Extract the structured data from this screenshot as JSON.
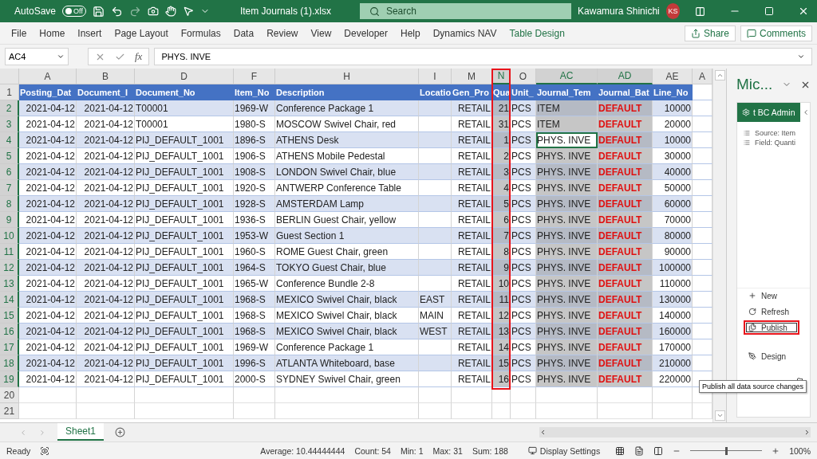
{
  "title_bar": {
    "autosave_label": "AutoSave",
    "autosave_text": "Off",
    "autosave_on": false,
    "file_name": "Item Journals (1).xlsx",
    "search_placeholder": "Search",
    "user_name": "Kawamura Shinichi",
    "user_initials": "KS"
  },
  "ribbon_tabs": [
    {
      "label": "File",
      "kind": "normal"
    },
    {
      "label": "Home",
      "kind": "normal"
    },
    {
      "label": "Insert",
      "kind": "normal"
    },
    {
      "label": "Page Layout",
      "kind": "normal"
    },
    {
      "label": "Formulas",
      "kind": "normal"
    },
    {
      "label": "Data",
      "kind": "normal"
    },
    {
      "label": "Review",
      "kind": "normal"
    },
    {
      "label": "View",
      "kind": "normal"
    },
    {
      "label": "Developer",
      "kind": "normal"
    },
    {
      "label": "Help",
      "kind": "normal"
    },
    {
      "label": "Dynamics NAV",
      "kind": "normal"
    },
    {
      "label": "Table Design",
      "kind": "contextual"
    }
  ],
  "ribbon_buttons": [
    {
      "label": "Share",
      "kind": "share"
    },
    {
      "label": "Comments",
      "kind": "comments"
    }
  ],
  "formula_bar": {
    "name_box": "AC4",
    "function_label": "fx",
    "value": "PHYS. INVE"
  },
  "sheet": {
    "columns": [
      {
        "letter": "A",
        "header": "Posting_Dat",
        "kind": "right",
        "selected": false,
        "highlighted": false
      },
      {
        "letter": "B",
        "header": "Document_I",
        "kind": "right",
        "selected": false,
        "highlighted": false
      },
      {
        "letter": "D",
        "header": "Document_No",
        "kind": "left",
        "selected": false,
        "highlighted": false
      },
      {
        "letter": "F",
        "header": "Item_No",
        "kind": "left",
        "selected": false,
        "highlighted": false
      },
      {
        "letter": "H",
        "header": "Description",
        "kind": "left",
        "selected": false,
        "highlighted": false
      },
      {
        "letter": "I",
        "header": "Locatio",
        "kind": "left",
        "selected": false,
        "highlighted": false
      },
      {
        "letter": "M",
        "header": "Gen_Pro",
        "kind": "right",
        "selected": false,
        "highlighted": false
      },
      {
        "letter": "N",
        "header": "Qua",
        "kind": "right",
        "selected": true,
        "highlighted": true
      },
      {
        "letter": "O",
        "header": "Unit_",
        "kind": "left",
        "selected": false,
        "highlighted": false
      },
      {
        "letter": "AC",
        "header": "Journal_Tem",
        "kind": "left",
        "selected": true,
        "highlighted": false
      },
      {
        "letter": "AD",
        "header": "Journal_Bat",
        "kind": "emphasis",
        "selected": true,
        "highlighted": false
      },
      {
        "letter": "AE",
        "header": "Line_No",
        "kind": "right",
        "selected": false,
        "highlighted": false
      },
      {
        "letter": "A"
      }
    ],
    "header_row": {
      "number": "1",
      "selected": false
    },
    "rows": [
      {
        "number": "2",
        "selected": true,
        "cells": [
          "2021-04-12",
          "2021-04-12",
          "T00001",
          "1969-W",
          "Conference Package 1",
          "",
          "RETAIL",
          "21",
          "PCS",
          "ITEM",
          "DEFAULT",
          "10000"
        ]
      },
      {
        "number": "3",
        "selected": true,
        "cells": [
          "2021-04-12",
          "2021-04-12",
          "T00001",
          "1980-S",
          "MOSCOW Swivel Chair, red",
          "",
          "RETAIL",
          "31",
          "PCS",
          "ITEM",
          "DEFAULT",
          "20000"
        ]
      },
      {
        "number": "4",
        "selected": true,
        "cells": [
          "2021-04-12",
          "2021-04-12",
          "PIJ_DEFAULT_1001",
          "1896-S",
          "ATHENS Desk",
          "",
          "RETAIL",
          "1",
          "PCS",
          {
            "text": "PHYS. INVE",
            "active": true
          },
          "DEFAULT",
          "10000"
        ]
      },
      {
        "number": "5",
        "selected": true,
        "cells": [
          "2021-04-12",
          "2021-04-12",
          "PIJ_DEFAULT_1001",
          "1906-S",
          "ATHENS Mobile Pedestal",
          "",
          "RETAIL",
          "2",
          "PCS",
          "PHYS. INVE",
          "DEFAULT",
          "30000"
        ]
      },
      {
        "number": "6",
        "selected": true,
        "cells": [
          "2021-04-12",
          "2021-04-12",
          "PIJ_DEFAULT_1001",
          "1908-S",
          "LONDON Swivel Chair, blue",
          "",
          "RETAIL",
          "3",
          "PCS",
          "PHYS. INVE",
          "DEFAULT",
          "40000"
        ]
      },
      {
        "number": "7",
        "selected": true,
        "cells": [
          "2021-04-12",
          "2021-04-12",
          "PIJ_DEFAULT_1001",
          "1920-S",
          "ANTWERP Conference Table",
          "",
          "RETAIL",
          "4",
          "PCS",
          "PHYS. INVE",
          "DEFAULT",
          "50000"
        ]
      },
      {
        "number": "8",
        "selected": true,
        "cells": [
          "2021-04-12",
          "2021-04-12",
          "PIJ_DEFAULT_1001",
          "1928-S",
          "AMSTERDAM Lamp",
          "",
          "RETAIL",
          "5",
          "PCS",
          "PHYS. INVE",
          "DEFAULT",
          "60000"
        ]
      },
      {
        "number": "9",
        "selected": true,
        "cells": [
          "2021-04-12",
          "2021-04-12",
          "PIJ_DEFAULT_1001",
          "1936-S",
          "BERLIN Guest Chair, yellow",
          "",
          "RETAIL",
          "6",
          "PCS",
          "PHYS. INVE",
          "DEFAULT",
          "70000"
        ]
      },
      {
        "number": "10",
        "selected": true,
        "cells": [
          "2021-04-12",
          "2021-04-12",
          "PIJ_DEFAULT_1001",
          "1953-W",
          "Guest Section 1",
          "",
          "RETAIL",
          "7",
          "PCS",
          "PHYS. INVE",
          "DEFAULT",
          "80000"
        ]
      },
      {
        "number": "11",
        "selected": true,
        "cells": [
          "2021-04-12",
          "2021-04-12",
          "PIJ_DEFAULT_1001",
          "1960-S",
          "ROME Guest Chair, green",
          "",
          "RETAIL",
          "8",
          "PCS",
          "PHYS. INVE",
          "DEFAULT",
          "90000"
        ]
      },
      {
        "number": "12",
        "selected": true,
        "cells": [
          "2021-04-12",
          "2021-04-12",
          "PIJ_DEFAULT_1001",
          "1964-S",
          "TOKYO Guest Chair, blue",
          "",
          "RETAIL",
          "9",
          "PCS",
          "PHYS. INVE",
          "DEFAULT",
          "100000"
        ]
      },
      {
        "number": "13",
        "selected": true,
        "cells": [
          "2021-04-12",
          "2021-04-12",
          "PIJ_DEFAULT_1001",
          "1965-W",
          "Conference Bundle 2-8",
          "",
          "RETAIL",
          "10",
          "PCS",
          "PHYS. INVE",
          "DEFAULT",
          "110000"
        ]
      },
      {
        "number": "14",
        "selected": true,
        "cells": [
          "2021-04-12",
          "2021-04-12",
          "PIJ_DEFAULT_1001",
          "1968-S",
          "MEXICO Swivel Chair, black",
          "EAST",
          "RETAIL",
          "11",
          "PCS",
          "PHYS. INVE",
          "DEFAULT",
          "130000"
        ]
      },
      {
        "number": "15",
        "selected": true,
        "cells": [
          "2021-04-12",
          "2021-04-12",
          "PIJ_DEFAULT_1001",
          "1968-S",
          "MEXICO Swivel Chair, black",
          "MAIN",
          "RETAIL",
          "12",
          "PCS",
          "PHYS. INVE",
          "DEFAULT",
          "140000"
        ]
      },
      {
        "number": "16",
        "selected": true,
        "cells": [
          "2021-04-12",
          "2021-04-12",
          "PIJ_DEFAULT_1001",
          "1968-S",
          "MEXICO Swivel Chair, black",
          "WEST",
          "RETAIL",
          "13",
          "PCS",
          "PHYS. INVE",
          "DEFAULT",
          "160000"
        ]
      },
      {
        "number": "17",
        "selected": true,
        "cells": [
          "2021-04-12",
          "2021-04-12",
          "PIJ_DEFAULT_1001",
          "1969-W",
          "Conference Package 1",
          "",
          "RETAIL",
          "14",
          "PCS",
          "PHYS. INVE",
          "DEFAULT",
          "170000"
        ]
      },
      {
        "number": "18",
        "selected": true,
        "cells": [
          "2021-04-12",
          "2021-04-12",
          "PIJ_DEFAULT_1001",
          "1996-S",
          "ATLANTA Whiteboard, base",
          "",
          "RETAIL",
          "15",
          "PCS",
          "PHYS. INVE",
          "DEFAULT",
          "210000"
        ]
      },
      {
        "number": "19",
        "selected": true,
        "cells": [
          "2021-04-12",
          "2021-04-12",
          "PIJ_DEFAULT_1001",
          "2000-S",
          "SYDNEY Swivel Chair, green",
          "",
          "RETAIL",
          "16",
          "PCS",
          "PHYS. INVE",
          "DEFAULT",
          "220000"
        ]
      }
    ],
    "empty_rows": [
      {
        "number": "20",
        "selected": false
      },
      {
        "number": "21",
        "selected": false
      }
    ],
    "sheet_tabs": [
      {
        "label": "Sheet1",
        "selected": true
      }
    ]
  },
  "side_pane": {
    "title": "Mic...",
    "connect_button": "t BC Admin",
    "info": [
      {
        "label": "Source: Item"
      },
      {
        "label": "Field: Quanti"
      }
    ],
    "actions": [
      {
        "label": "New",
        "kind": "new",
        "highlighted": false
      },
      {
        "label": "Refresh",
        "kind": "refresh",
        "highlighted": false
      },
      {
        "label": "Publish",
        "kind": "publish",
        "highlighted": true
      },
      {
        "label": "Design",
        "kind": "design",
        "highlighted": false
      }
    ],
    "tooltip": "Publish all data source changes"
  },
  "status_bar": {
    "mode": "Ready",
    "stats": [
      "Average: 10.44444444",
      "Count: 54",
      "Min: 1",
      "Max: 31",
      "Sum: 188"
    ],
    "display_settings": "Display Settings",
    "zoom": "100%",
    "zoom_slider": {
      "level": 0.5
    }
  }
}
